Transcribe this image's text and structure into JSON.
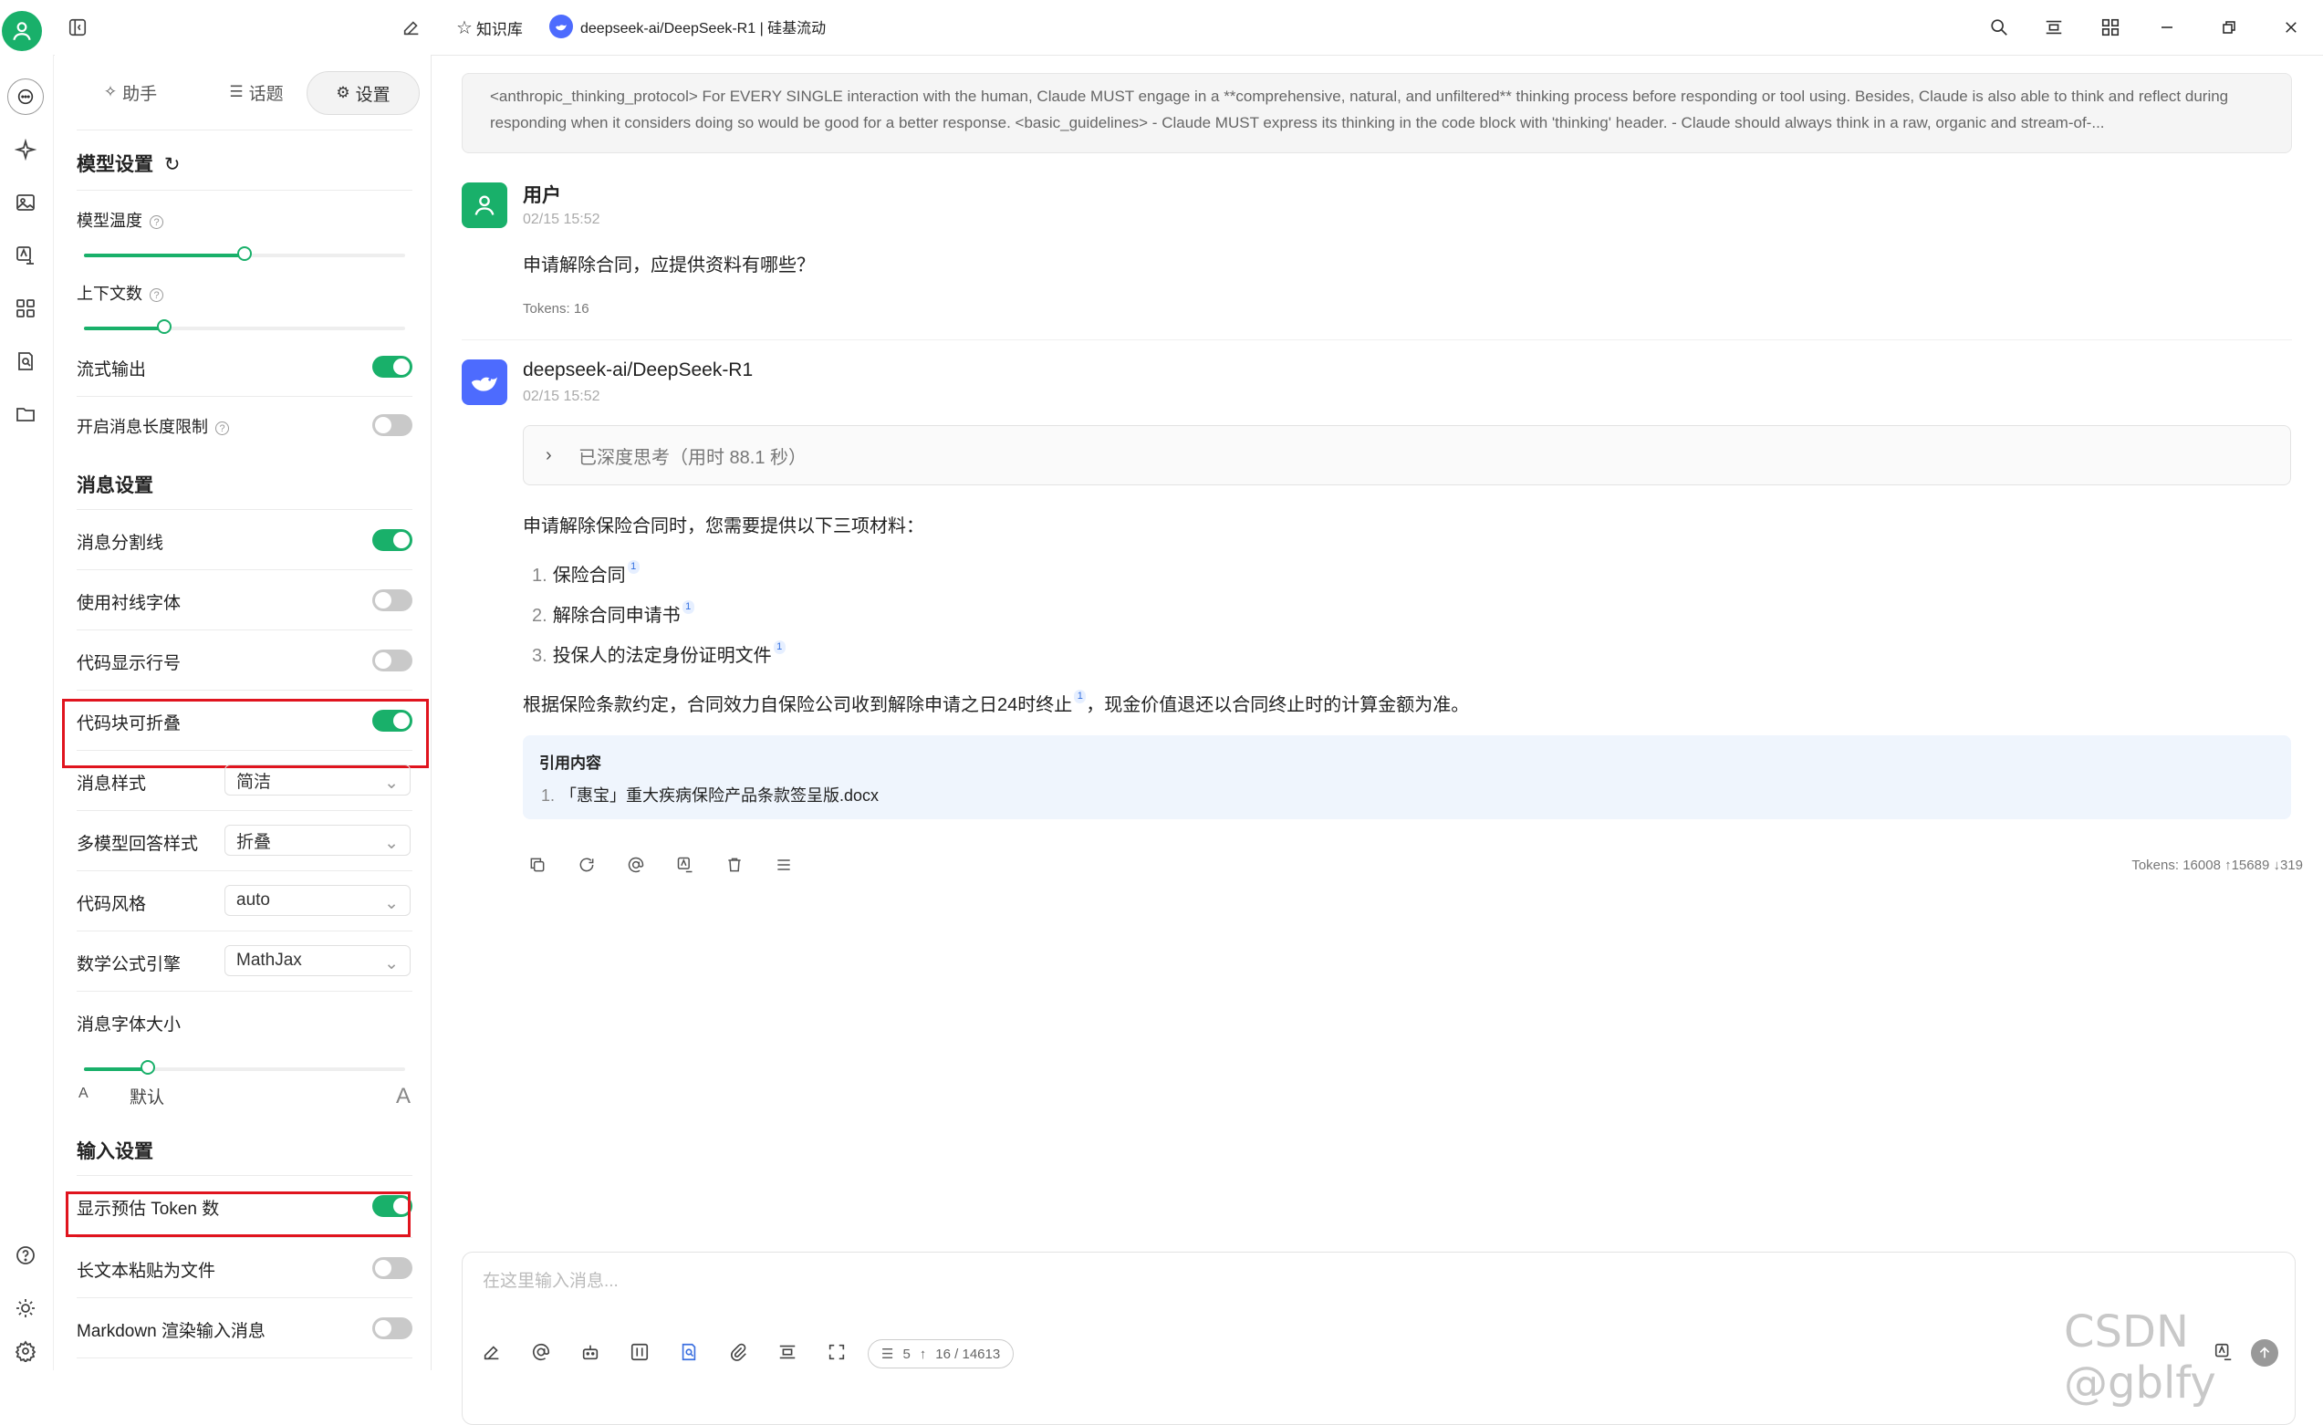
{
  "topbar": {
    "kb_label": "知识库",
    "model_label": "deepseek-ai/DeepSeek-R1 | 硅基流动"
  },
  "tabs": {
    "assistant": "助手",
    "topic": "话题",
    "settings": "设置"
  },
  "model_settings": {
    "title": "模型设置",
    "temperature_label": "模型温度",
    "temperature_fraction": 0.5,
    "context_label": "上下文数",
    "context_fraction": 0.25,
    "stream_label": "流式输出",
    "stream_on": true,
    "length_limit_label": "开启消息长度限制",
    "length_limit_on": false
  },
  "message_settings": {
    "title": "消息设置",
    "divider_label": "消息分割线",
    "serif_label": "使用衬线字体",
    "line_numbers_label": "代码显示行号",
    "collapsible_label": "代码块可折叠",
    "style_label": "消息样式",
    "style_value": "简洁",
    "multi_label": "多模型回答样式",
    "multi_value": "折叠",
    "code_style_label": "代码风格",
    "code_style_value": "auto",
    "math_label": "数学公式引擎",
    "math_value": "MathJax",
    "font_size_label": "消息字体大小",
    "font_size_fraction": 0.2,
    "font_small": "A",
    "font_default": "默认",
    "font_large": "A"
  },
  "input_settings": {
    "title": "输入设置",
    "token_label": "显示预估 Token 数",
    "paste_label": "长文本粘贴为文件",
    "markdown_label": "Markdown 渲染输入消息"
  },
  "system_prompt": "<anthropic_thinking_protocol> For EVERY SINGLE interaction with the human, Claude MUST engage in a **comprehensive, natural, and unfiltered** thinking process before responding or tool using. Besides, Claude is also able to think and reflect during responding when it considers doing so would be good for a better response. <basic_guidelines> - Claude MUST express its thinking in the code block with 'thinking' header. - Claude should always think in a raw, organic and stream-of-...",
  "user_msg": {
    "author": "用户",
    "time": "02/15 15:52",
    "text": "申请解除合同，应提供资料有哪些？",
    "tokens": "Tokens: 16"
  },
  "bot_msg": {
    "author": "deepseek-ai/DeepSeek-R1",
    "time": "02/15 15:52",
    "thinking": "已深度思考（用时 88.1 秒）",
    "intro": "申请解除保险合同时，您需要提供以下三项材料：",
    "items": [
      {
        "num": "1.",
        "text": "保险合同"
      },
      {
        "num": "2.",
        "text": "解除合同申请书"
      },
      {
        "num": "3.",
        "text": "投保人的法定身份证明文件"
      }
    ],
    "cite_mark": "1",
    "para_a": "根据保险条款约定，合同效力自保险公司收到解除申请之日24时终止",
    "para_b": "，现金价值退还以合同终止时的计算金额为准。",
    "quote_title": "引用内容",
    "quote_num": "1.",
    "quote_item": "「惠宝」重大疾病保险产品条款签呈版.docx",
    "tokens": "Tokens: 16008 ↑15689 ↓319"
  },
  "input": {
    "placeholder": "在这里输入消息...",
    "ctx_count": "5",
    "token_count": "16 / 14613"
  },
  "watermark": "CSDN @gblfy",
  "colors": {
    "accent": "#19b06a",
    "highlight": "#e0141e",
    "bot_avatar": "#4d6bfe"
  }
}
